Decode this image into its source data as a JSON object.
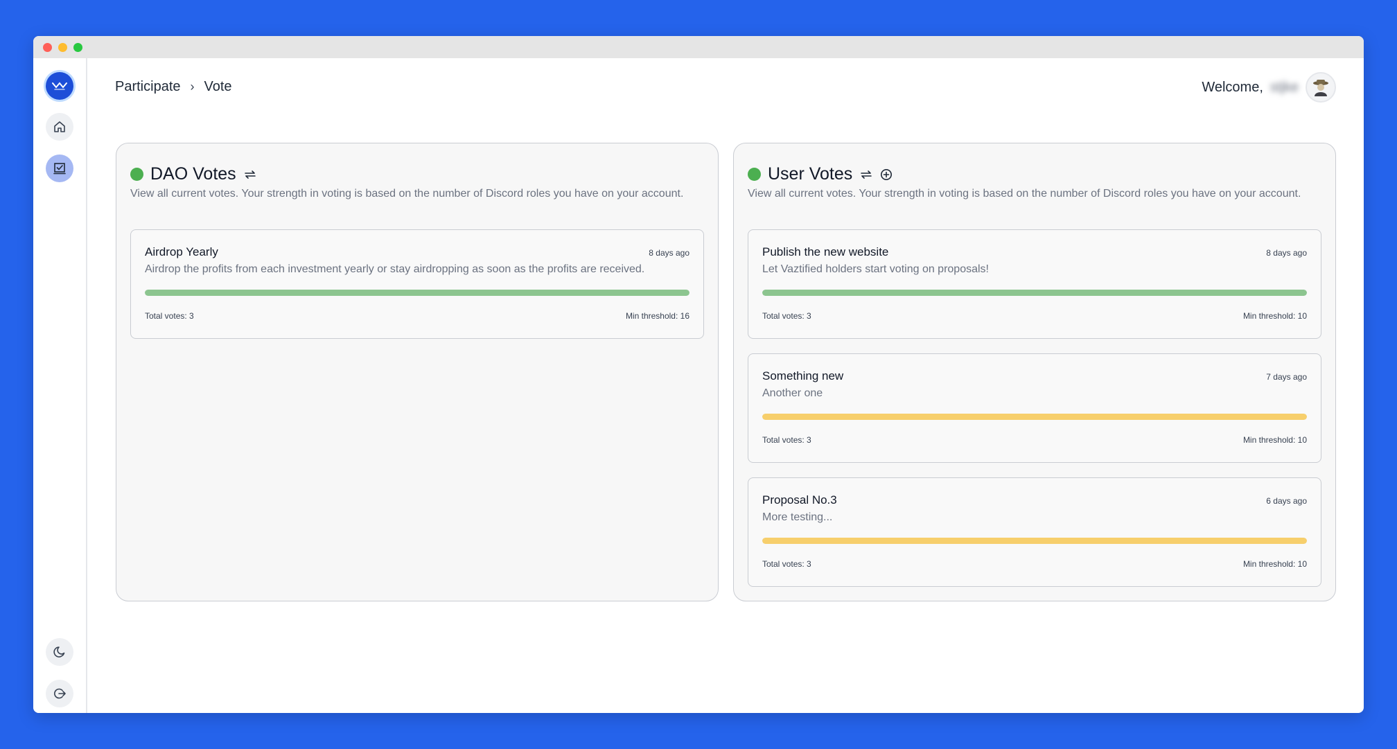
{
  "window": {
    "traffic_lights": [
      "close",
      "minimize",
      "maximize"
    ]
  },
  "sidebar": {
    "items": [
      {
        "icon": "logo-icon"
      },
      {
        "icon": "home-icon"
      },
      {
        "icon": "vote-icon"
      },
      {
        "icon": "moon-icon"
      },
      {
        "icon": "logout-icon"
      }
    ]
  },
  "breadcrumb": {
    "parent": "Participate",
    "separator": "›",
    "current": "Vote"
  },
  "header": {
    "welcome": "Welcome,",
    "username": "stjke"
  },
  "panels": {
    "dao": {
      "title": "DAO Votes",
      "description": "View all current votes. Your strength in voting is based on the number of Discord roles you have on your account.",
      "votes": [
        {
          "title": "Airdrop Yearly",
          "time": "8 days ago",
          "description": "Airdrop the profits from each investment yearly or stay airdropping as soon as the profits are received.",
          "progress": 1.0,
          "progress_color": "#8cc58f",
          "total": "Total votes: 3",
          "threshold": "Min threshold: 16"
        }
      ]
    },
    "user": {
      "title": "User Votes",
      "description": "View all current votes. Your strength in voting is based on the number of Discord roles you have on your account.",
      "votes": [
        {
          "title": "Publish the new website",
          "time": "8 days ago",
          "description": "Let Vaztified holders start voting on proposals!",
          "progress": 1.0,
          "progress_color": "#8cc58f",
          "total": "Total votes: 3",
          "threshold": "Min threshold: 10"
        },
        {
          "title": "Something new",
          "time": "7 days ago",
          "description": "Another one",
          "progress": 1.0,
          "progress_color": "#f7cf6c",
          "total": "Total votes: 3",
          "threshold": "Min threshold: 10"
        },
        {
          "title": "Proposal No.3",
          "time": "6 days ago",
          "description": "More testing...",
          "progress": 1.0,
          "progress_color": "#f7cf6c",
          "total": "Total votes: 3",
          "threshold": "Min threshold: 10"
        }
      ]
    }
  },
  "colors": {
    "background": "#2563eb",
    "accent": "#1d4ed8",
    "status_dot": "#4caf50"
  }
}
